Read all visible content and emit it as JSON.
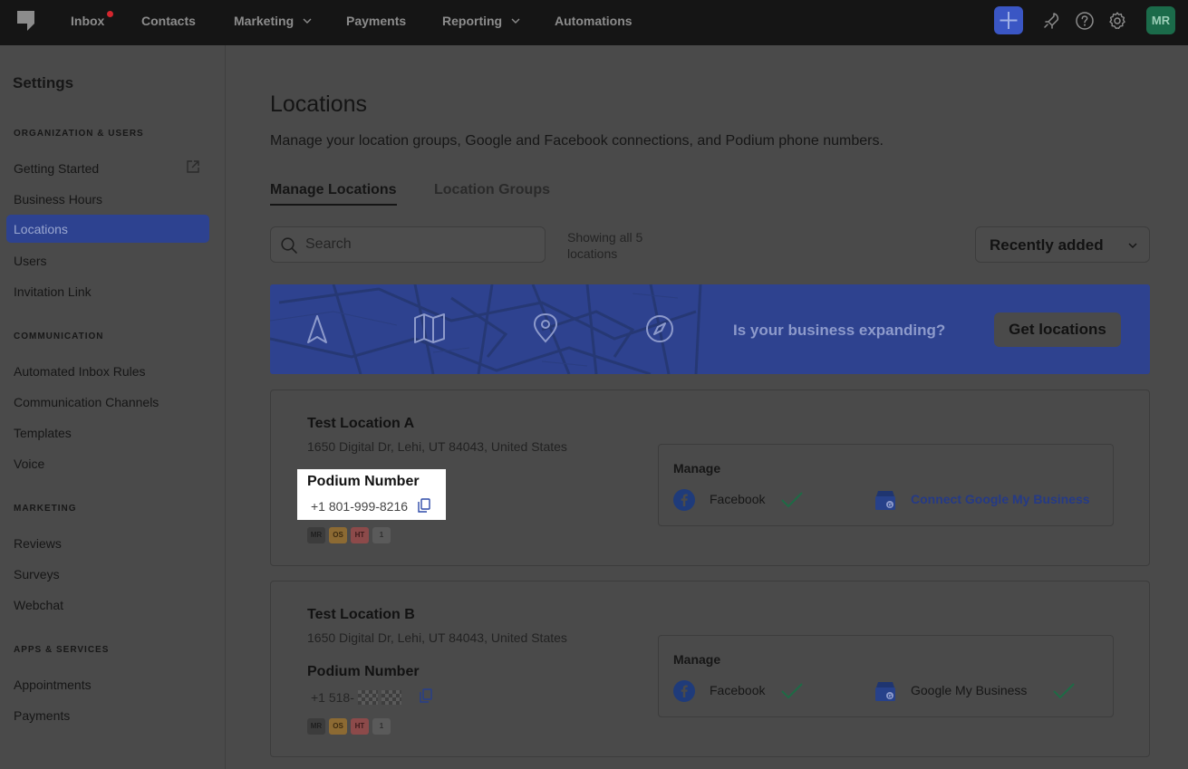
{
  "nav": {
    "items": [
      {
        "label": "Inbox",
        "has_dot": true
      },
      {
        "label": "Contacts"
      },
      {
        "label": "Marketing",
        "has_chevron": true
      },
      {
        "label": "Payments"
      },
      {
        "label": "Reporting",
        "has_chevron": true
      },
      {
        "label": "Automations"
      }
    ],
    "avatar_initials": "MR",
    "icons": [
      "plus-icon",
      "rocket-icon",
      "help-icon",
      "gear-icon"
    ]
  },
  "sidebar": {
    "title": "Settings",
    "sections": [
      {
        "heading": "ORGANIZATION & USERS",
        "items": [
          "Getting Started",
          "Business Hours",
          "Locations",
          "Users",
          "Invitation Link"
        ]
      },
      {
        "heading": "COMMUNICATION",
        "items": [
          "Automated Inbox Rules",
          "Communication Channels",
          "Templates",
          "Voice"
        ]
      },
      {
        "heading": "MARKETING",
        "items": [
          "Reviews",
          "Surveys",
          "Webchat"
        ]
      },
      {
        "heading": "APPS & SERVICES",
        "items": [
          "Appointments",
          "Payments"
        ]
      }
    ],
    "active_item": "Locations"
  },
  "main": {
    "title": "Locations",
    "description": "Manage your location groups, Google and Facebook connections, and Podium phone numbers.",
    "tabs": [
      {
        "label": "Manage Locations",
        "active": true
      },
      {
        "label": "Location Groups",
        "active": false
      }
    ],
    "search": {
      "placeholder": "Search",
      "value": ""
    },
    "showing_text": "Showing all 5 locations",
    "sort": {
      "selected": "Recently added"
    },
    "banner": {
      "text": "Is your business expanding?",
      "button": "Get locations"
    },
    "locations": [
      {
        "name": "Test Location A",
        "address": "1650 Digital Dr, Lehi, UT 84043, United States",
        "number_title": "Podium Number",
        "number": "+1 801-999-8216",
        "user_chips": [
          "MR",
          "OS",
          "HT",
          "1"
        ],
        "manage_title": "Manage",
        "facebook_label": "Facebook",
        "facebook_connected": true,
        "google_label": "Connect Google My Business",
        "google_connected": false
      },
      {
        "name": "Test Location B",
        "address": "1650 Digital Dr, Lehi, UT 84043, United States",
        "number_title": "Podium Number",
        "number": "+1 518-",
        "user_chips": [
          "MR",
          "OS",
          "HT",
          "1"
        ],
        "manage_title": "Manage",
        "facebook_label": "Facebook",
        "facebook_connected": true,
        "google_label": "Google My Business",
        "google_connected": true
      }
    ]
  },
  "colors": {
    "nav_bg": "#151515",
    "overlay_bg": "#4a4a4a",
    "active_item_bg": "#2d4290",
    "banner_bg": "#2e428f",
    "accent_plus": "#3a56c4",
    "avatar_bg": "#1b6b4a",
    "check_green": "#1d6b45"
  }
}
